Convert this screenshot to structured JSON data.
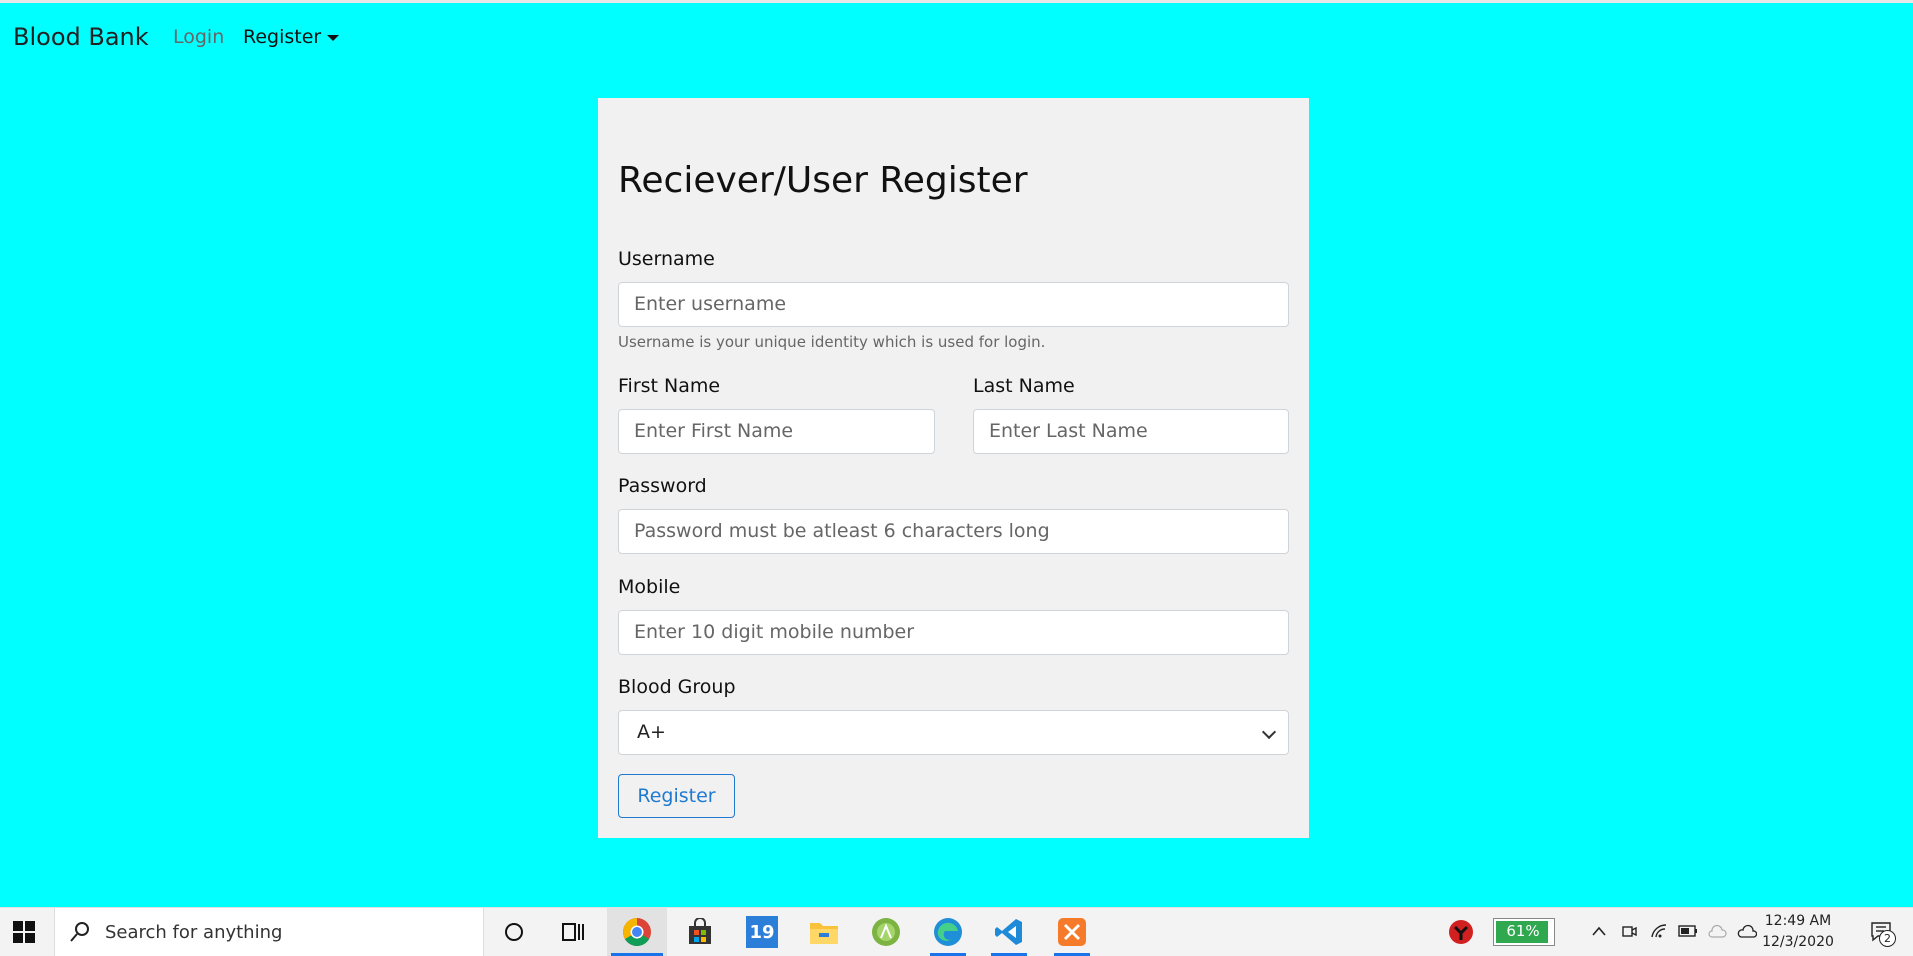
{
  "navbar": {
    "brand": "Blood Bank",
    "login": "Login",
    "register": "Register"
  },
  "form": {
    "title": "Reciever/User Register",
    "username_label": "Username",
    "username_placeholder": "Enter username",
    "username_help": "Username is your unique identity which is used for login.",
    "first_name_label": "First Name",
    "first_name_placeholder": "Enter First Name",
    "last_name_label": "Last Name",
    "last_name_placeholder": "Enter Last Name",
    "password_label": "Password",
    "password_placeholder": "Password must be atleast 6 characters long",
    "mobile_label": "Mobile",
    "mobile_placeholder": "Enter 10 digit mobile number",
    "blood_group_label": "Blood Group",
    "blood_group_value": "A+",
    "submit_label": "Register"
  },
  "taskbar": {
    "search_placeholder": "Search for anything",
    "app_badge": "19",
    "battery_percent": "61%",
    "time": "12:49 AM",
    "date": "12/3/2020",
    "notification_count": "2"
  },
  "colors": {
    "page_background": "#00ffff",
    "card_background": "#f1f1f1",
    "accent": "#1f7ad0"
  }
}
